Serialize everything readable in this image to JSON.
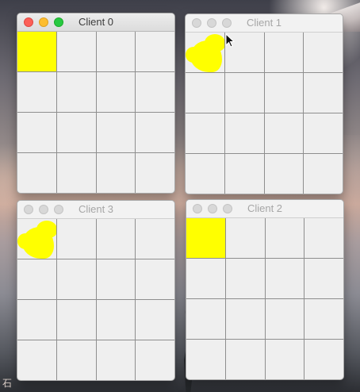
{
  "desktop": {
    "corner_text": "石"
  },
  "colors": {
    "fill": "#ffff00",
    "grid_line": "#8e8e8e",
    "cell_bg": "#efefef"
  },
  "windows": [
    {
      "title": "Client 0",
      "active": true,
      "filled_cells": [
        0
      ],
      "fill_style": "solid"
    },
    {
      "title": "Client 1",
      "active": false,
      "filled_cells": [
        0
      ],
      "fill_style": "scribble"
    },
    {
      "title": "Client 3",
      "active": false,
      "filled_cells": [
        0
      ],
      "fill_style": "scribble"
    },
    {
      "title": "Client 2",
      "active": false,
      "filled_cells": [
        0
      ],
      "fill_style": "solid"
    }
  ],
  "grid": {
    "rows": 4,
    "cols": 4
  }
}
